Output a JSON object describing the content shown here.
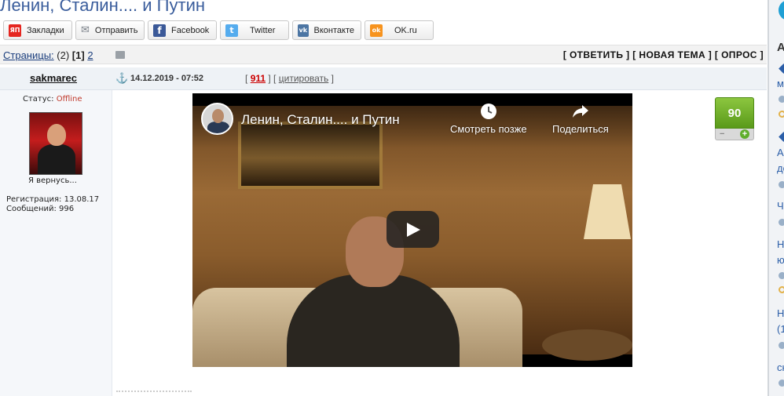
{
  "page": {
    "title": "Ленин, Сталин.... и Путин"
  },
  "share": {
    "buttons": [
      {
        "label": "Закладки",
        "icon": "yandex-icon",
        "icon_text": "ЯП",
        "color": "#e52620"
      },
      {
        "label": "Отправить",
        "icon": "mail-icon",
        "icon_text": "✉",
        "color": "#7a8088"
      },
      {
        "label": "Facebook",
        "icon": "facebook-icon",
        "icon_text": "f",
        "color": "#3b5998"
      },
      {
        "label": "Twitter",
        "icon": "twitter-icon",
        "icon_text": "t",
        "color": "#55acee"
      },
      {
        "label": "Вконтакте",
        "icon": "vk-icon",
        "icon_text": "vk",
        "color": "#4c75a3"
      },
      {
        "label": "OK.ru",
        "icon": "ok-icon",
        "icon_text": "ok",
        "color": "#f7931e"
      }
    ]
  },
  "pagination": {
    "label": "Страницы:",
    "count": "(2)",
    "current": "[1]",
    "next": "2"
  },
  "actions": {
    "text": "[ ОТВЕТИТЬ ] [ НОВАЯ ТЕМА ] [ ОПРОС ]"
  },
  "post": {
    "author": "sakmarec",
    "date": "14.12.2019 - 07:52",
    "number": "911",
    "bracket_open": "[",
    "bracket_mid": "] [",
    "cite_label": "цитировать",
    "bracket_close": "]",
    "status_label": "Статус:",
    "status_value": "Offline",
    "avatar_caption": "Я вернусь...",
    "registration": "Регистрация: 13.08.17",
    "messages": "Сообщений: 996",
    "rating": "90",
    "rating_minus": "−",
    "rating_plus": "+"
  },
  "video": {
    "title": "Ленин, Сталин.... и Путин",
    "watch_later": "Смотреть позже",
    "share": "Поделиться"
  },
  "sidebar": {
    "heading": "А",
    "items": [
      "му",
      "А",
      "до",
      "Ч",
      "Н",
      "ю",
      "Н",
      "(1",
      "сн"
    ]
  },
  "colors": {
    "title": "#3a5d9c",
    "link": "#1a3d7c",
    "vote_green": "#6cae2a",
    "offline": "#c0392b"
  }
}
